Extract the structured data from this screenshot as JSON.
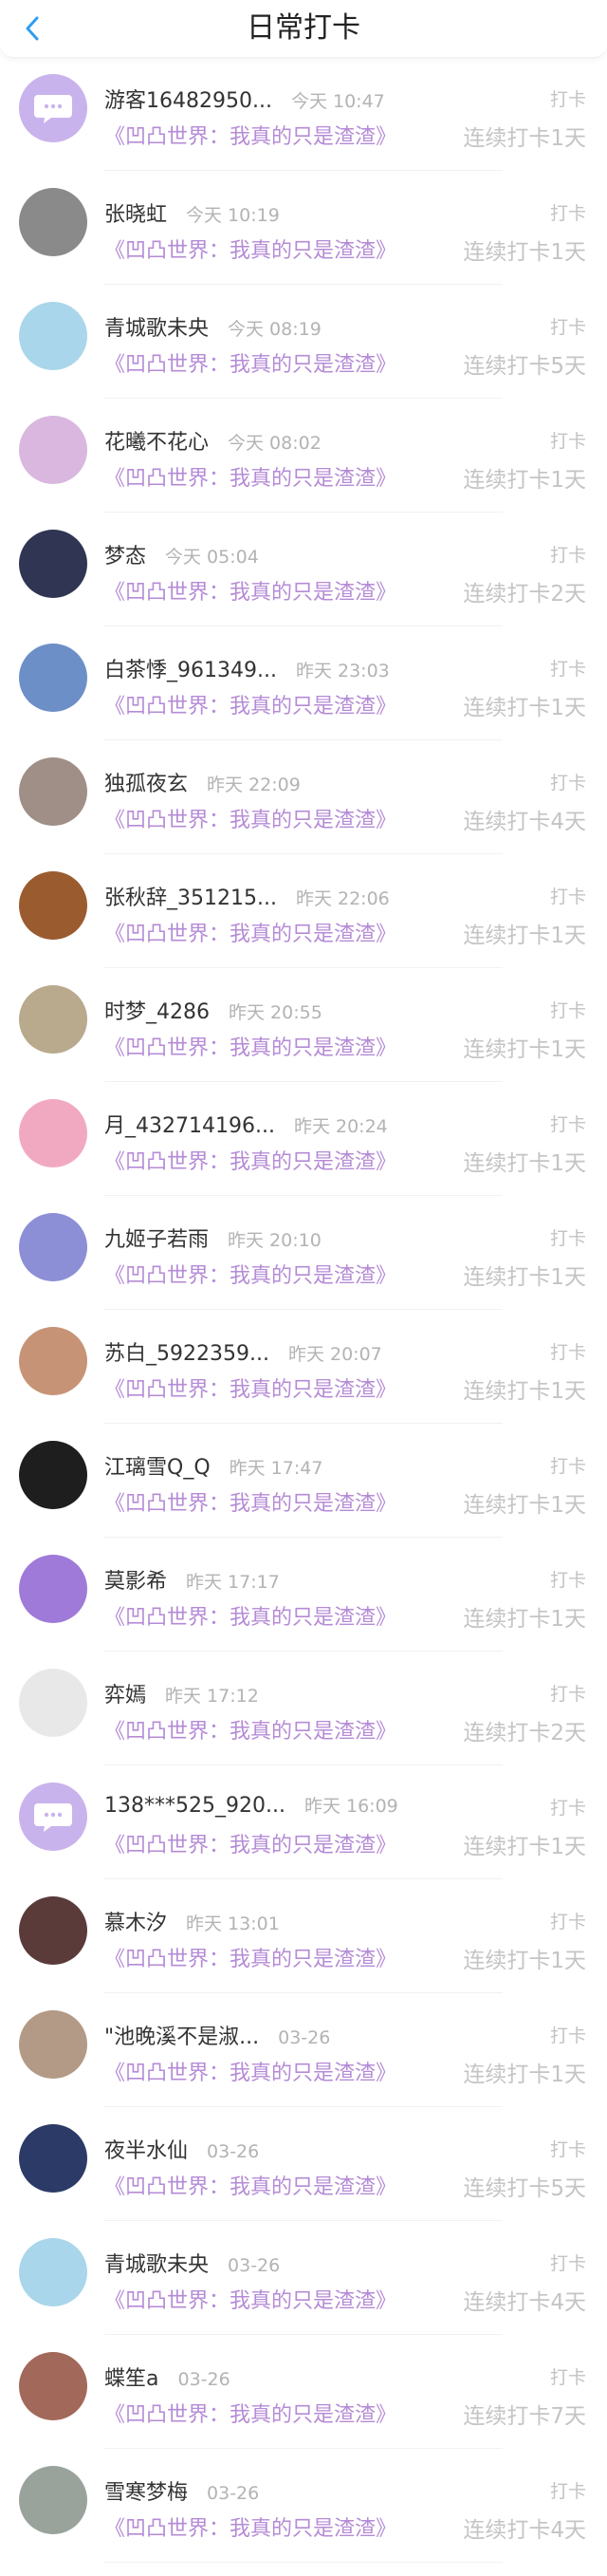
{
  "header": {
    "title": "日常打卡"
  },
  "entries": [
    {
      "name": "游客16482950...",
      "time": "今天 10:47",
      "book": "《凹凸世界：我真的只是渣渣》",
      "action": "打卡",
      "streak": "连续打卡1天",
      "avatar": "default-avatar",
      "color": "#c9b3ec"
    },
    {
      "name": "张晓虹",
      "time": "今天 10:19",
      "book": "《凹凸世界：我真的只是渣渣》",
      "action": "打卡",
      "streak": "连续打卡1天",
      "avatar": "user-avatar",
      "color": "#8a8a8a"
    },
    {
      "name": "青城歌未央",
      "time": "今天 08:19",
      "book": "《凹凸世界：我真的只是渣渣》",
      "action": "打卡",
      "streak": "连续打卡5天",
      "avatar": "user-avatar",
      "color": "#a9d6ea"
    },
    {
      "name": "花曦不花心",
      "time": "今天 08:02",
      "book": "《凹凸世界：我真的只是渣渣》",
      "action": "打卡",
      "streak": "连续打卡1天",
      "avatar": "user-avatar",
      "color": "#d9b7df"
    },
    {
      "name": "梦态",
      "time": "今天 05:04",
      "book": "《凹凸世界：我真的只是渣渣》",
      "action": "打卡",
      "streak": "连续打卡2天",
      "avatar": "user-avatar",
      "color": "#2f3552"
    },
    {
      "name": "白茶悸_961349...",
      "time": "昨天 23:03",
      "book": "《凹凸世界：我真的只是渣渣》",
      "action": "打卡",
      "streak": "连续打卡1天",
      "avatar": "user-avatar",
      "color": "#6d8fc8"
    },
    {
      "name": "独孤夜玄",
      "time": "昨天 22:09",
      "book": "《凹凸世界：我真的只是渣渣》",
      "action": "打卡",
      "streak": "连续打卡4天",
      "avatar": "user-avatar",
      "color": "#9f8f86"
    },
    {
      "name": "张秋辞_351215...",
      "time": "昨天 22:06",
      "book": "《凹凸世界：我真的只是渣渣》",
      "action": "打卡",
      "streak": "连续打卡1天",
      "avatar": "user-avatar",
      "color": "#9a5b2e"
    },
    {
      "name": "时梦_4286",
      "time": "昨天 20:55",
      "book": "《凹凸世界：我真的只是渣渣》",
      "action": "打卡",
      "streak": "连续打卡1天",
      "avatar": "user-avatar",
      "color": "#b9a98d"
    },
    {
      "name": "月_432714196...",
      "time": "昨天 20:24",
      "book": "《凹凸世界：我真的只是渣渣》",
      "action": "打卡",
      "streak": "连续打卡1天",
      "avatar": "user-avatar",
      "color": "#f1a9c2"
    },
    {
      "name": "九姬子若雨",
      "time": "昨天 20:10",
      "book": "《凹凸世界：我真的只是渣渣》",
      "action": "打卡",
      "streak": "连续打卡1天",
      "avatar": "user-avatar",
      "color": "#8c8fd6"
    },
    {
      "name": "苏白_5922359...",
      "time": "昨天 20:07",
      "book": "《凹凸世界：我真的只是渣渣》",
      "action": "打卡",
      "streak": "连续打卡1天",
      "avatar": "user-avatar",
      "color": "#c79377"
    },
    {
      "name": "江璃雪Q_Q",
      "time": "昨天 17:47",
      "book": "《凹凸世界：我真的只是渣渣》",
      "action": "打卡",
      "streak": "连续打卡1天",
      "avatar": "user-avatar",
      "color": "#1e1e1e"
    },
    {
      "name": "莫影希",
      "time": "昨天 17:17",
      "book": "《凹凸世界：我真的只是渣渣》",
      "action": "打卡",
      "streak": "连续打卡1天",
      "avatar": "user-avatar",
      "color": "#9f7ad9"
    },
    {
      "name": "弈嫣",
      "time": "昨天 17:12",
      "book": "《凹凸世界：我真的只是渣渣》",
      "action": "打卡",
      "streak": "连续打卡2天",
      "avatar": "user-avatar",
      "color": "#e8e8e8"
    },
    {
      "name": "138***525_920...",
      "time": "昨天 16:09",
      "book": "《凹凸世界：我真的只是渣渣》",
      "action": "打卡",
      "streak": "连续打卡1天",
      "avatar": "default-avatar",
      "color": "#c9b3ec"
    },
    {
      "name": "慕木汐",
      "time": "昨天 13:01",
      "book": "《凹凸世界：我真的只是渣渣》",
      "action": "打卡",
      "streak": "连续打卡1天",
      "avatar": "user-avatar",
      "color": "#5a3b3a"
    },
    {
      "name": "\"池晚溪不是淑...",
      "time": "03-26",
      "book": "《凹凸世界：我真的只是渣渣》",
      "action": "打卡",
      "streak": "连续打卡1天",
      "avatar": "user-avatar",
      "color": "#b39a86"
    },
    {
      "name": "夜半水仙",
      "time": "03-26",
      "book": "《凹凸世界：我真的只是渣渣》",
      "action": "打卡",
      "streak": "连续打卡5天",
      "avatar": "user-avatar",
      "color": "#2b3a66"
    },
    {
      "name": "青城歌未央",
      "time": "03-26",
      "book": "《凹凸世界：我真的只是渣渣》",
      "action": "打卡",
      "streak": "连续打卡4天",
      "avatar": "user-avatar",
      "color": "#a9d6ea"
    },
    {
      "name": "蝶笙a",
      "time": "03-26",
      "book": "《凹凸世界：我真的只是渣渣》",
      "action": "打卡",
      "streak": "连续打卡7天",
      "avatar": "user-avatar",
      "color": "#a2685a"
    },
    {
      "name": "雪寒梦梅",
      "time": "03-26",
      "book": "《凹凸世界：我真的只是渣渣》",
      "action": "打卡",
      "streak": "连续打卡4天",
      "avatar": "user-avatar",
      "color": "#9aa39b"
    }
  ]
}
